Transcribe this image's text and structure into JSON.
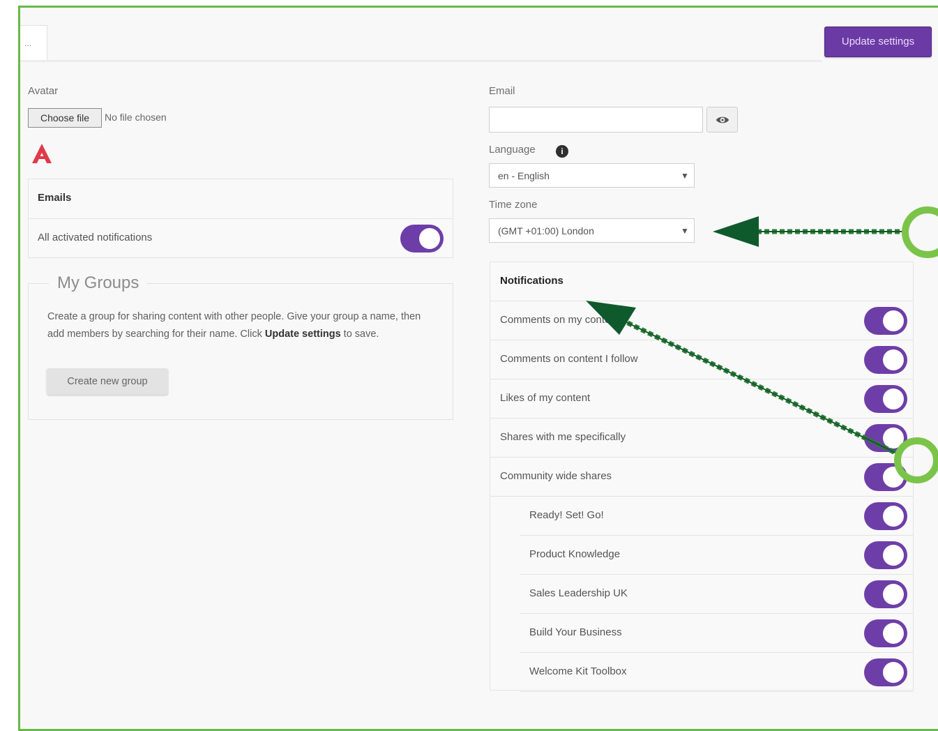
{
  "header": {
    "tab_stub": "...",
    "update_button": "Update settings"
  },
  "left": {
    "avatar_label": "Avatar",
    "file_button": "Choose file",
    "file_status": "No file chosen",
    "emails_panel": {
      "title": "Emails",
      "row_label": "All activated notifications",
      "row_on": true
    },
    "groups": {
      "legend": "My Groups",
      "desc_part1": "Create a group for sharing content with other people. Give your group a name, then add members by searching for their name. Click ",
      "desc_bold": "Update settings",
      "desc_part2": " to save.",
      "create_button": "Create new group"
    }
  },
  "right": {
    "email_label": "Email",
    "email_value": "",
    "language_label": "Language",
    "language_value": "en - English",
    "timezone_label": "Time zone",
    "timezone_value": "(GMT +01:00) London",
    "notifications": {
      "title": "Notifications",
      "items": [
        {
          "label": "Comments on my content",
          "on": true
        },
        {
          "label": "Comments on content I follow",
          "on": true
        },
        {
          "label": "Likes of my content",
          "on": true
        },
        {
          "label": "Shares with me specifically",
          "on": true
        },
        {
          "label": "Community wide shares",
          "on": true
        }
      ],
      "communities": [
        {
          "label": "Ready! Set! Go!",
          "on": true
        },
        {
          "label": "Product Knowledge",
          "on": true
        },
        {
          "label": "Sales Leadership UK",
          "on": true
        },
        {
          "label": "Build Your Business",
          "on": true
        },
        {
          "label": "Welcome Kit Toolbox",
          "on": true
        }
      ]
    }
  },
  "colors": {
    "accent_purple": "#6e3ea8",
    "frame_green": "#69b84a",
    "arrow_dark_green": "#0f5a2c",
    "logo_red": "#e03a4a"
  },
  "icons": {
    "eye": "eye-icon",
    "info": "info-icon",
    "chevron": "chevron-down-icon",
    "logo": "brand-logo-icon"
  }
}
